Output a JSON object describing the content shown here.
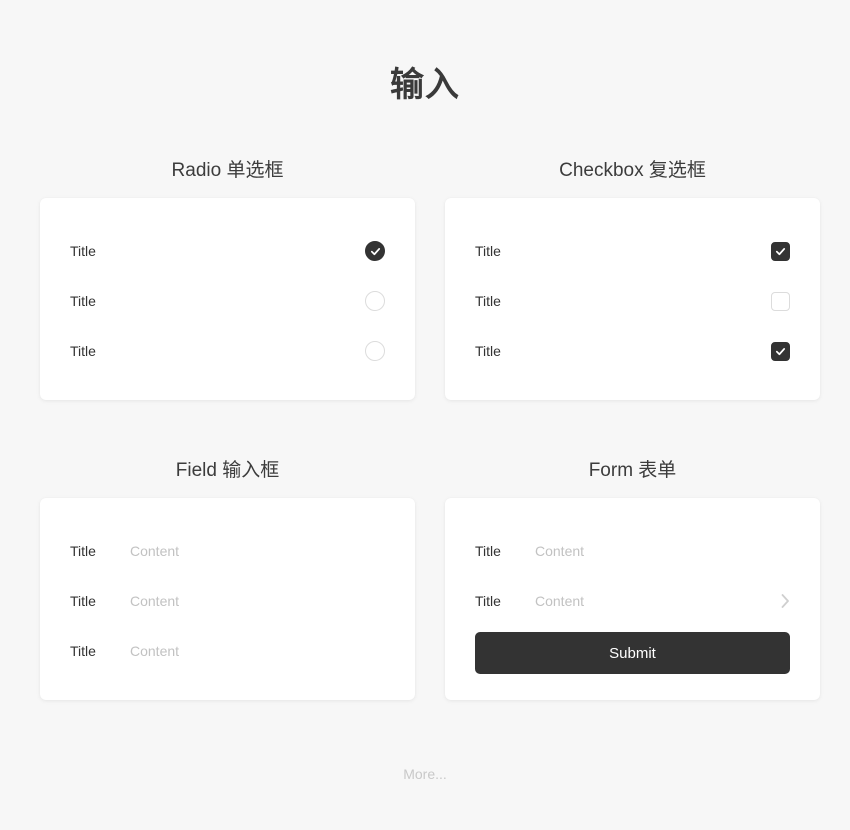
{
  "page": {
    "title": "输入",
    "background_color": "#f7f7f7",
    "accent_color": "#333333",
    "placeholder_color": "#c2c2c2"
  },
  "sections": {
    "radio": {
      "header": "Radio 单选框",
      "items": [
        {
          "label": "Title",
          "state": "on",
          "icon": "radio-checked-icon"
        },
        {
          "label": "Title",
          "state": "off",
          "icon": "radio-unchecked-icon"
        },
        {
          "label": "Title",
          "state": "off",
          "icon": "radio-unchecked-icon"
        }
      ]
    },
    "checkbox": {
      "header": "Checkbox 复选框",
      "items": [
        {
          "label": "Title",
          "state": "on",
          "icon": "checkbox-checked-icon"
        },
        {
          "label": "Title",
          "state": "off",
          "icon": "checkbox-unchecked-icon"
        },
        {
          "label": "Title",
          "state": "on",
          "icon": "checkbox-checked-icon"
        }
      ]
    },
    "field": {
      "header": "Field 输入框",
      "items": [
        {
          "label": "Title",
          "value": "",
          "placeholder": "Content"
        },
        {
          "label": "Title",
          "value": "",
          "placeholder": "Content"
        },
        {
          "label": "Title",
          "value": "",
          "placeholder": "Content"
        }
      ]
    },
    "form": {
      "header": "Form 表单",
      "items": [
        {
          "label": "Title",
          "value": "",
          "placeholder": "Content",
          "chevron": ""
        },
        {
          "label": "Title",
          "value": "",
          "placeholder": "Content",
          "chevron": "chevron-right-icon"
        }
      ],
      "submit_label": "Submit"
    }
  },
  "footer": {
    "more_label": "More..."
  }
}
